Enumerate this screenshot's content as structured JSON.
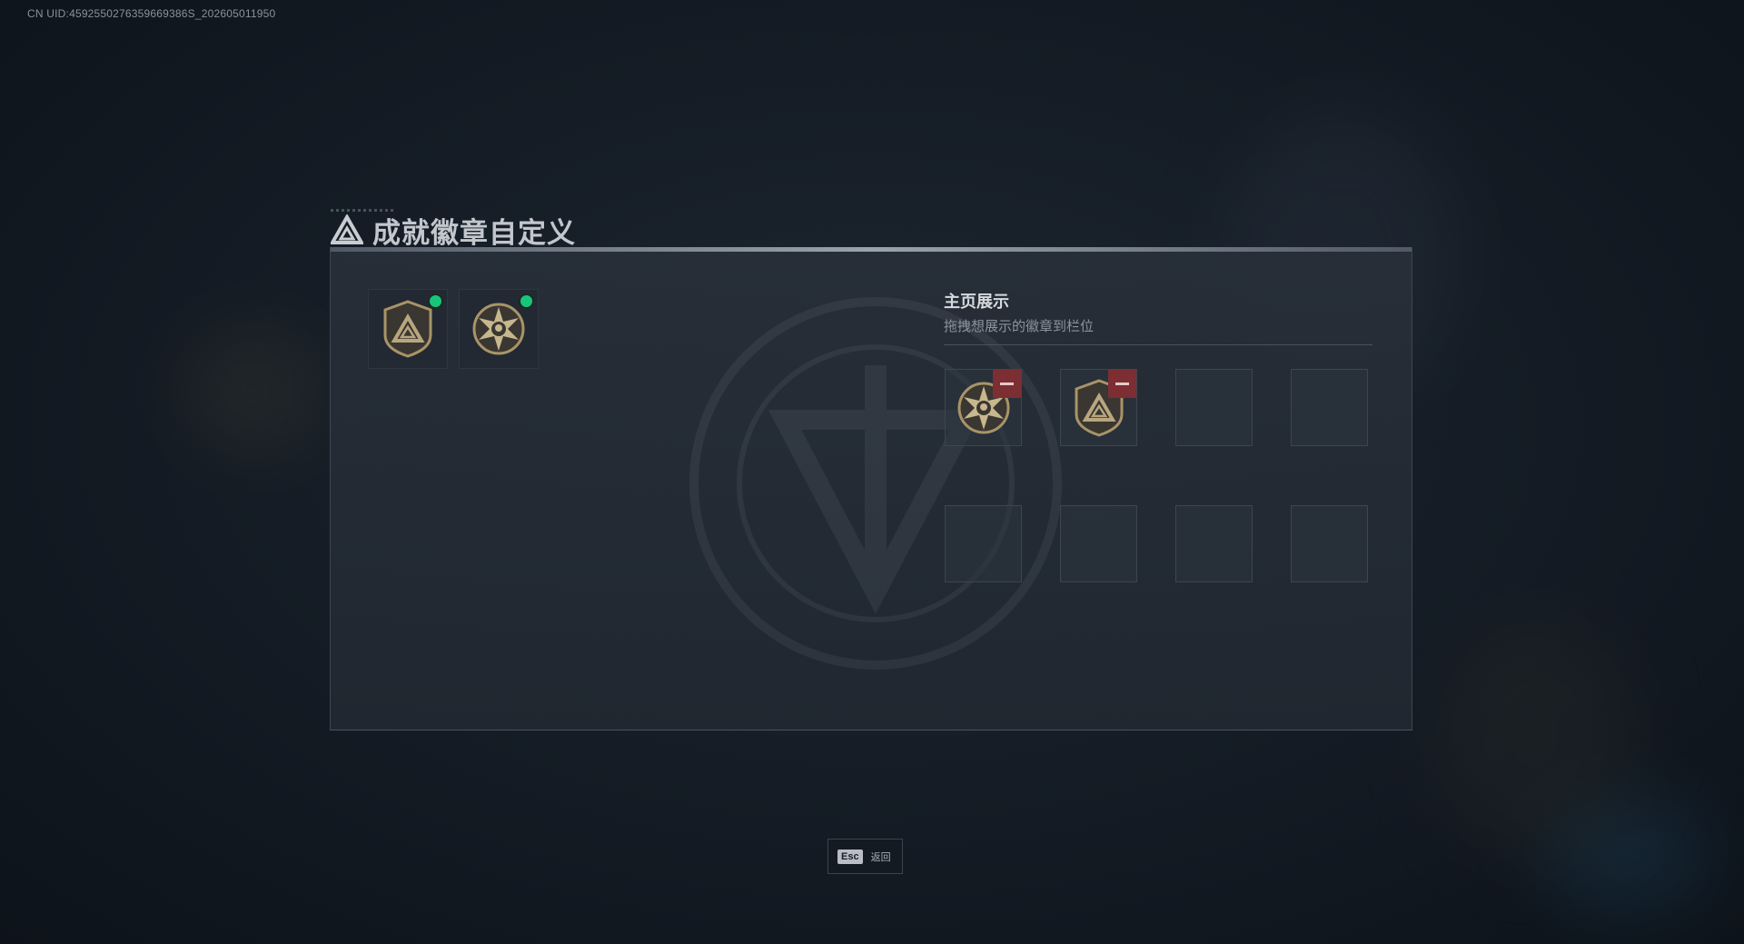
{
  "uid_text": "CN UID:4592550276359669386S_202605011950",
  "title": "成就徽章自定义",
  "owned_badges": [
    {
      "icon": "shield-triangle-badge-icon",
      "equipped": true
    },
    {
      "icon": "star-skull-badge-icon",
      "equipped": true
    }
  ],
  "display": {
    "title": "主页展示",
    "subtitle": "拖拽想展示的徽章到栏位",
    "slots": [
      {
        "icon": "star-skull-badge-icon",
        "filled": true
      },
      {
        "icon": "shield-triangle-badge-icon",
        "filled": true
      },
      {
        "filled": false
      },
      {
        "filled": false
      },
      {
        "filled": false
      },
      {
        "filled": false
      },
      {
        "filled": false
      },
      {
        "filled": false
      }
    ]
  },
  "footer": {
    "key": "Esc",
    "label": "返回"
  },
  "colors": {
    "equipped_dot": "#16c77a",
    "remove_button": "#7c2e33",
    "badge_gold": "#a89468"
  }
}
